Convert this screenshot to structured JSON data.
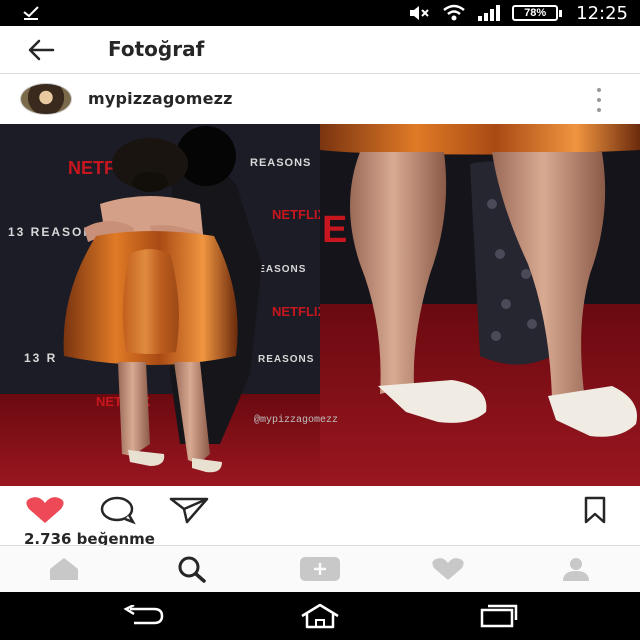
{
  "status_bar": {
    "battery": "78%",
    "time": "12:25"
  },
  "header": {
    "title": "Fotoğraf"
  },
  "post": {
    "username": "mypizzagomezz",
    "watermark": "@mypizzagomezz",
    "backdrop_texts": [
      "NETFLIX",
      "13 REASONS WHY",
      "REASONS",
      "NETFLIX",
      "REASONS",
      "NETFLIX",
      "13 R",
      "REASONS",
      "NETFLIX"
    ],
    "likes": "2.736 beğenme"
  },
  "colors": {
    "like_red": "#ed4956",
    "dress_orange": "#c8641a",
    "carpet_red": "#8a1016",
    "backdrop": "#1c1c26"
  },
  "icons": {
    "back": "arrow-left-icon",
    "more": "more-vertical-icon",
    "like": "heart-filled-icon",
    "comment": "comment-icon",
    "share": "send-icon",
    "save": "bookmark-icon",
    "home": "home-icon",
    "search": "search-icon",
    "add": "plus-square-icon",
    "activity": "heart-icon",
    "profile": "user-icon"
  }
}
